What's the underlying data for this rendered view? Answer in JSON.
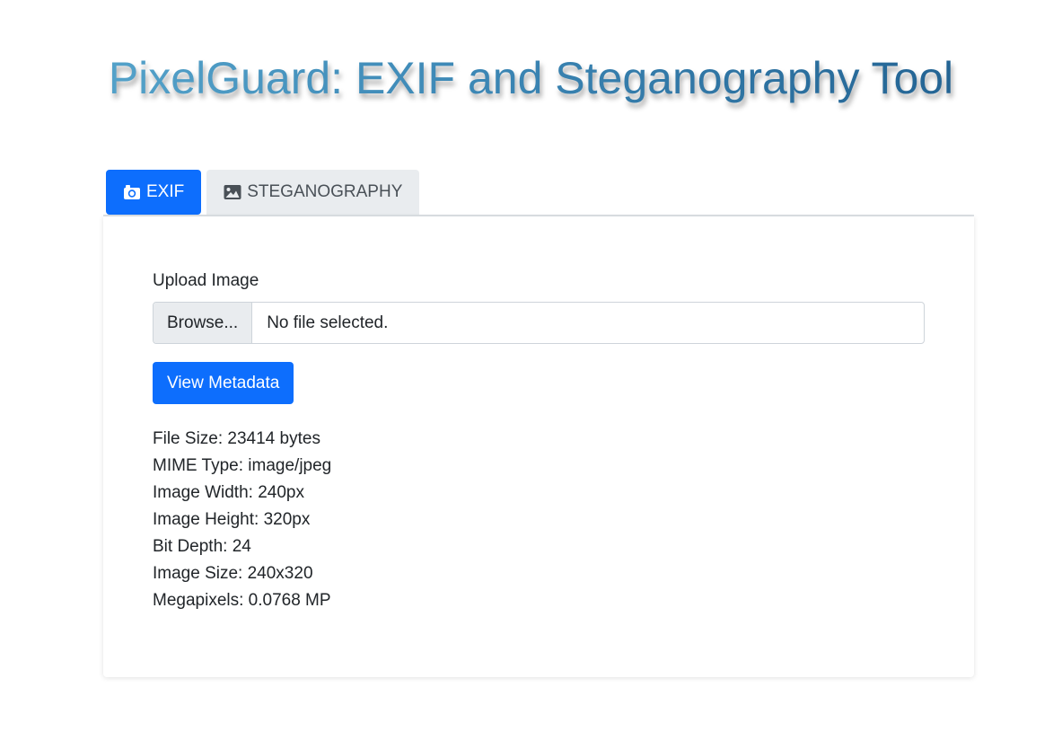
{
  "app": {
    "title": "PixelGuard: EXIF and Steganography Tool"
  },
  "tabs": [
    {
      "label": "EXIF",
      "icon": "camera-icon",
      "active": true
    },
    {
      "label": "STEGANOGRAPHY",
      "icon": "image-icon",
      "active": false
    }
  ],
  "upload": {
    "label": "Upload Image",
    "browse_label": "Browse...",
    "file_status": "No file selected."
  },
  "actions": {
    "view_metadata_label": "View Metadata"
  },
  "metadata": [
    "File Size: 23414 bytes",
    "MIME Type: image/jpeg",
    "Image Width: 240px",
    "Image Height: 320px",
    "Bit Depth: 24",
    "Image Size: 240x320",
    "Megapixels: 0.0768 MP"
  ],
  "colors": {
    "primary": "#0d6efd",
    "tab_inactive_bg": "#e9ecef",
    "title_gradient_start": "#5aa9cf",
    "title_gradient_end": "#1e5c8c"
  }
}
